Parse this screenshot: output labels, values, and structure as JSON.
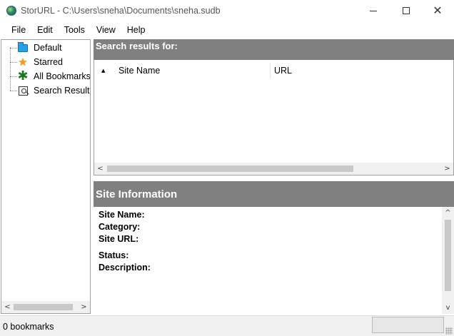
{
  "window": {
    "title": "StorURL - C:\\Users\\sneha\\Documents\\sneha.sudb",
    "close_glyph": "✕"
  },
  "menu": [
    "File",
    "Edit",
    "Tools",
    "View",
    "Help"
  ],
  "tree": {
    "items": [
      {
        "label": "Default",
        "icon": "folder-icon"
      },
      {
        "label": "Starred",
        "icon": "star-icon"
      },
      {
        "label": "All Bookmarks",
        "icon": "asterisk-icon"
      },
      {
        "label": "Search Results",
        "icon": "search-results-icon"
      }
    ],
    "selected": "Search Results"
  },
  "results": {
    "header": "Search results for:",
    "sort_glyph": "▲",
    "columns": [
      "Site Name",
      "URL"
    ],
    "rows": []
  },
  "site_info": {
    "header": "Site Information",
    "fields": [
      "Site Name:",
      "Category:",
      "Site URL:",
      "Status:",
      "Description:"
    ]
  },
  "scroll_glyphs": {
    "left": "<",
    "right": ">",
    "up": "^",
    "down": "v"
  },
  "status": {
    "text": "0 bookmarks",
    "progress_fraction": 0
  },
  "colors": {
    "panel_header": "#808080",
    "progress": "#06b025"
  }
}
